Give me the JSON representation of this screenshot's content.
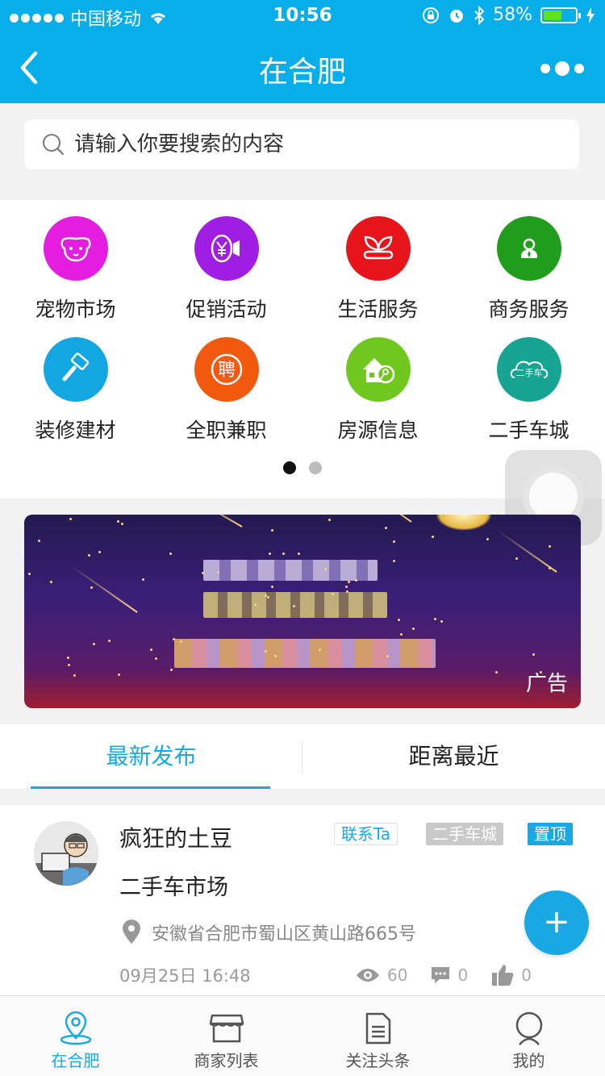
{
  "status_bar": {
    "carrier": "中国移动",
    "time": "10:56",
    "battery": "58%",
    "battery_level": 0.58
  },
  "nav": {
    "title": "在合肥"
  },
  "search": {
    "placeholder": "请输入你要搜索的内容"
  },
  "categories": [
    {
      "label": "宠物市场",
      "icon": "pet-dog-icon",
      "color": "#e51de0"
    },
    {
      "label": "促销活动",
      "icon": "promotion-icon",
      "color": "#a01ee3"
    },
    {
      "label": "生活服务",
      "icon": "sprout-icon",
      "color": "#e8141c"
    },
    {
      "label": "商务服务",
      "icon": "business-person-icon",
      "color": "#1f9d1b"
    },
    {
      "label": "装修建材",
      "icon": "paint-roller-icon",
      "color": "#12a6e3"
    },
    {
      "label": "全职兼职",
      "icon": "hire-icon",
      "color": "#f15a0e",
      "glyph": "聘"
    },
    {
      "label": "房源信息",
      "icon": "house-key-icon",
      "color": "#70c81e"
    },
    {
      "label": "二手车城",
      "icon": "used-car-icon",
      "color": "#17a593",
      "glyph": "二手车"
    }
  ],
  "pager": {
    "total": 2,
    "current": 0
  },
  "banner": {
    "ad_label": "广告"
  },
  "tabs": [
    {
      "label": "最新发布",
      "active": true
    },
    {
      "label": "距离最近",
      "active": false
    }
  ],
  "post": {
    "author": "疯狂的土豆",
    "contact_label": "联系Ta",
    "category": "二手车城",
    "pinned_label": "置顶",
    "title": "二手车市场",
    "address": "安徽省合肥市蜀山区黄山路665号",
    "date": "09月25日 16:48",
    "views": "60",
    "comments": "0",
    "likes": "0"
  },
  "fab": {
    "label": "+"
  },
  "tabbar": [
    {
      "label": "在合肥",
      "icon": "location-pin-icon",
      "active": true
    },
    {
      "label": "商家列表",
      "icon": "store-icon",
      "active": false
    },
    {
      "label": "关注头条",
      "icon": "document-icon",
      "active": false
    },
    {
      "label": "我的",
      "icon": "user-icon",
      "active": false
    }
  ],
  "colors": {
    "primary": "#08aeea",
    "accent": "#19a8e4"
  }
}
